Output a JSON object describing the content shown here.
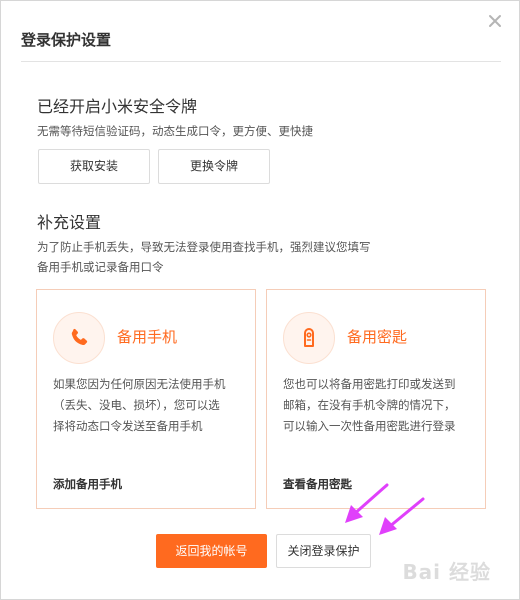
{
  "dialog": {
    "title": "登录保护设置",
    "close_icon": "close-icon"
  },
  "token_section": {
    "title": "已经开启小米安全令牌",
    "description": "无需等待短信验证码，动态生成口令，更方便、更快捷",
    "get_install_label": "获取安装",
    "change_token_label": "更换令牌"
  },
  "supplement": {
    "title": "补充设置",
    "desc_line1": "为了防止手机丢失，导致无法登录使用查找手机，强烈建议您填写",
    "desc_line2": "备用手机或记录备用口令"
  },
  "cards": [
    {
      "icon": "phone-icon",
      "title": "备用手机",
      "desc_lines": [
        "如果您因为任何原因无法使用手机",
        "（丢失、没电、损坏），您可以选",
        "择将动态口令发送至备用手机"
      ],
      "link": "添加备用手机"
    },
    {
      "icon": "key-tag-icon",
      "title": "备用密匙",
      "desc_lines": [
        "您也可以将备用密匙打印或发送到",
        "邮箱，在没有手机令牌的情况下，",
        "可以输入一次性备用密匙进行登录"
      ],
      "link": "查看备用密匙"
    }
  ],
  "footer": {
    "back_label": "返回我的帐号",
    "close_protection_label": "关闭登录保护"
  },
  "colors": {
    "accent": "#ff6a1f",
    "annotation_arrow": "#e040fb"
  },
  "watermark": "Bai 经验"
}
